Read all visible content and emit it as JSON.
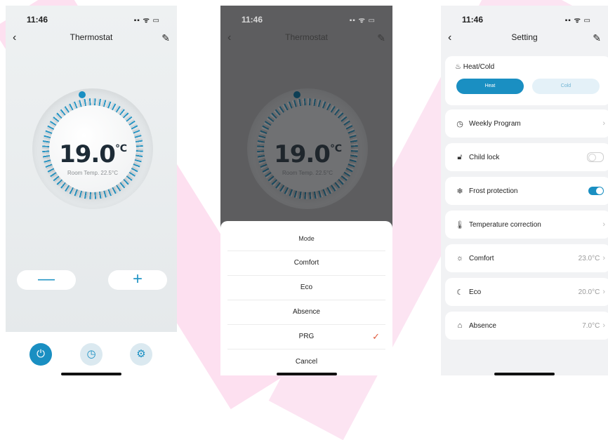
{
  "screen1": {
    "time": "11:46",
    "status_icons": "▪▪ ᯤ ▭",
    "title": "Thermostat",
    "temperature": "19.0",
    "unit": "℃",
    "room_temp": "Room Temp. 22.5°C",
    "minus": "—",
    "plus": "+"
  },
  "screen2": {
    "time": "11:46",
    "status_icons": "▪▪ ᯤ ▭",
    "title": "Thermostat",
    "temperature": "19.0",
    "unit": "℃",
    "room_temp": "Room Temp. 22.5°C",
    "sheet": {
      "title": "Mode",
      "options": [
        "Comfort",
        "Eco",
        "Absence",
        "PRG"
      ],
      "selected": "PRG",
      "cancel": "Cancel"
    }
  },
  "screen3": {
    "time": "11:46",
    "status_icons": "▪▪ ᯤ ▭",
    "title": "Setting",
    "heat_cold": {
      "label": "Heat/Cold",
      "heat": "Heat",
      "cold": "Cold",
      "selected": "Heat"
    },
    "rows": {
      "weekly": "Weekly Program",
      "child_lock": "Child lock",
      "frost": "Frost protection",
      "correction": "Temperature correction",
      "comfort": "Comfort",
      "comfort_val": "23.0°C",
      "eco": "Eco",
      "eco_val": "20.0°C",
      "absence": "Absence",
      "absence_val": "7.0°C"
    },
    "child_lock_on": false,
    "frost_on": true
  },
  "colors": {
    "accent": "#1a8fc2",
    "check": "#e05a3c",
    "background_stripe": "#fde0f0"
  }
}
